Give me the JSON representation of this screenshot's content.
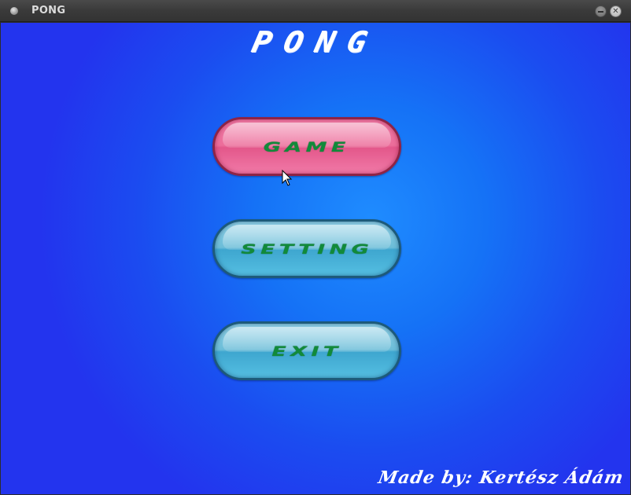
{
  "window": {
    "title": "PONG",
    "app_icon": "app-icon",
    "minimize_icon": "minimize-icon",
    "close_icon": "close-icon",
    "close_glyph": "✕"
  },
  "game": {
    "title": "PONG",
    "menu": [
      {
        "id": "game",
        "label": "GAME",
        "color": "#ec6d9a"
      },
      {
        "id": "setting",
        "label": "SETTING",
        "color": "#6bbdd8"
      },
      {
        "id": "exit",
        "label": "EXIT",
        "color": "#6bbdd8"
      }
    ],
    "credit": "Made by: Kertész Ádám",
    "label_color": "#118a3a",
    "background_color": "#1f6cf5"
  }
}
